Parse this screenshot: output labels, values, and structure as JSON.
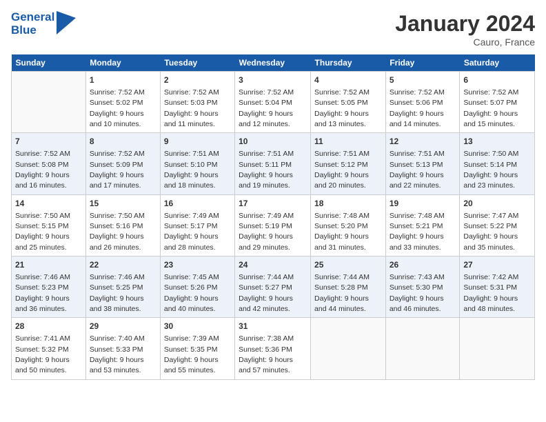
{
  "header": {
    "logo_line1": "General",
    "logo_line2": "Blue",
    "month": "January 2024",
    "location": "Cauro, France"
  },
  "days_of_week": [
    "Sunday",
    "Monday",
    "Tuesday",
    "Wednesday",
    "Thursday",
    "Friday",
    "Saturday"
  ],
  "weeks": [
    [
      {
        "day": "",
        "sunrise": "",
        "sunset": "",
        "daylight": ""
      },
      {
        "day": "1",
        "sunrise": "Sunrise: 7:52 AM",
        "sunset": "Sunset: 5:02 PM",
        "daylight": "Daylight: 9 hours and 10 minutes."
      },
      {
        "day": "2",
        "sunrise": "Sunrise: 7:52 AM",
        "sunset": "Sunset: 5:03 PM",
        "daylight": "Daylight: 9 hours and 11 minutes."
      },
      {
        "day": "3",
        "sunrise": "Sunrise: 7:52 AM",
        "sunset": "Sunset: 5:04 PM",
        "daylight": "Daylight: 9 hours and 12 minutes."
      },
      {
        "day": "4",
        "sunrise": "Sunrise: 7:52 AM",
        "sunset": "Sunset: 5:05 PM",
        "daylight": "Daylight: 9 hours and 13 minutes."
      },
      {
        "day": "5",
        "sunrise": "Sunrise: 7:52 AM",
        "sunset": "Sunset: 5:06 PM",
        "daylight": "Daylight: 9 hours and 14 minutes."
      },
      {
        "day": "6",
        "sunrise": "Sunrise: 7:52 AM",
        "sunset": "Sunset: 5:07 PM",
        "daylight": "Daylight: 9 hours and 15 minutes."
      }
    ],
    [
      {
        "day": "7",
        "sunrise": "Sunrise: 7:52 AM",
        "sunset": "Sunset: 5:08 PM",
        "daylight": "Daylight: 9 hours and 16 minutes."
      },
      {
        "day": "8",
        "sunrise": "Sunrise: 7:52 AM",
        "sunset": "Sunset: 5:09 PM",
        "daylight": "Daylight: 9 hours and 17 minutes."
      },
      {
        "day": "9",
        "sunrise": "Sunrise: 7:51 AM",
        "sunset": "Sunset: 5:10 PM",
        "daylight": "Daylight: 9 hours and 18 minutes."
      },
      {
        "day": "10",
        "sunrise": "Sunrise: 7:51 AM",
        "sunset": "Sunset: 5:11 PM",
        "daylight": "Daylight: 9 hours and 19 minutes."
      },
      {
        "day": "11",
        "sunrise": "Sunrise: 7:51 AM",
        "sunset": "Sunset: 5:12 PM",
        "daylight": "Daylight: 9 hours and 20 minutes."
      },
      {
        "day": "12",
        "sunrise": "Sunrise: 7:51 AM",
        "sunset": "Sunset: 5:13 PM",
        "daylight": "Daylight: 9 hours and 22 minutes."
      },
      {
        "day": "13",
        "sunrise": "Sunrise: 7:50 AM",
        "sunset": "Sunset: 5:14 PM",
        "daylight": "Daylight: 9 hours and 23 minutes."
      }
    ],
    [
      {
        "day": "14",
        "sunrise": "Sunrise: 7:50 AM",
        "sunset": "Sunset: 5:15 PM",
        "daylight": "Daylight: 9 hours and 25 minutes."
      },
      {
        "day": "15",
        "sunrise": "Sunrise: 7:50 AM",
        "sunset": "Sunset: 5:16 PM",
        "daylight": "Daylight: 9 hours and 26 minutes."
      },
      {
        "day": "16",
        "sunrise": "Sunrise: 7:49 AM",
        "sunset": "Sunset: 5:17 PM",
        "daylight": "Daylight: 9 hours and 28 minutes."
      },
      {
        "day": "17",
        "sunrise": "Sunrise: 7:49 AM",
        "sunset": "Sunset: 5:19 PM",
        "daylight": "Daylight: 9 hours and 29 minutes."
      },
      {
        "day": "18",
        "sunrise": "Sunrise: 7:48 AM",
        "sunset": "Sunset: 5:20 PM",
        "daylight": "Daylight: 9 hours and 31 minutes."
      },
      {
        "day": "19",
        "sunrise": "Sunrise: 7:48 AM",
        "sunset": "Sunset: 5:21 PM",
        "daylight": "Daylight: 9 hours and 33 minutes."
      },
      {
        "day": "20",
        "sunrise": "Sunrise: 7:47 AM",
        "sunset": "Sunset: 5:22 PM",
        "daylight": "Daylight: 9 hours and 35 minutes."
      }
    ],
    [
      {
        "day": "21",
        "sunrise": "Sunrise: 7:46 AM",
        "sunset": "Sunset: 5:23 PM",
        "daylight": "Daylight: 9 hours and 36 minutes."
      },
      {
        "day": "22",
        "sunrise": "Sunrise: 7:46 AM",
        "sunset": "Sunset: 5:25 PM",
        "daylight": "Daylight: 9 hours and 38 minutes."
      },
      {
        "day": "23",
        "sunrise": "Sunrise: 7:45 AM",
        "sunset": "Sunset: 5:26 PM",
        "daylight": "Daylight: 9 hours and 40 minutes."
      },
      {
        "day": "24",
        "sunrise": "Sunrise: 7:44 AM",
        "sunset": "Sunset: 5:27 PM",
        "daylight": "Daylight: 9 hours and 42 minutes."
      },
      {
        "day": "25",
        "sunrise": "Sunrise: 7:44 AM",
        "sunset": "Sunset: 5:28 PM",
        "daylight": "Daylight: 9 hours and 44 minutes."
      },
      {
        "day": "26",
        "sunrise": "Sunrise: 7:43 AM",
        "sunset": "Sunset: 5:30 PM",
        "daylight": "Daylight: 9 hours and 46 minutes."
      },
      {
        "day": "27",
        "sunrise": "Sunrise: 7:42 AM",
        "sunset": "Sunset: 5:31 PM",
        "daylight": "Daylight: 9 hours and 48 minutes."
      }
    ],
    [
      {
        "day": "28",
        "sunrise": "Sunrise: 7:41 AM",
        "sunset": "Sunset: 5:32 PM",
        "daylight": "Daylight: 9 hours and 50 minutes."
      },
      {
        "day": "29",
        "sunrise": "Sunrise: 7:40 AM",
        "sunset": "Sunset: 5:33 PM",
        "daylight": "Daylight: 9 hours and 53 minutes."
      },
      {
        "day": "30",
        "sunrise": "Sunrise: 7:39 AM",
        "sunset": "Sunset: 5:35 PM",
        "daylight": "Daylight: 9 hours and 55 minutes."
      },
      {
        "day": "31",
        "sunrise": "Sunrise: 7:38 AM",
        "sunset": "Sunset: 5:36 PM",
        "daylight": "Daylight: 9 hours and 57 minutes."
      },
      {
        "day": "",
        "sunrise": "",
        "sunset": "",
        "daylight": ""
      },
      {
        "day": "",
        "sunrise": "",
        "sunset": "",
        "daylight": ""
      },
      {
        "day": "",
        "sunrise": "",
        "sunset": "",
        "daylight": ""
      }
    ]
  ]
}
